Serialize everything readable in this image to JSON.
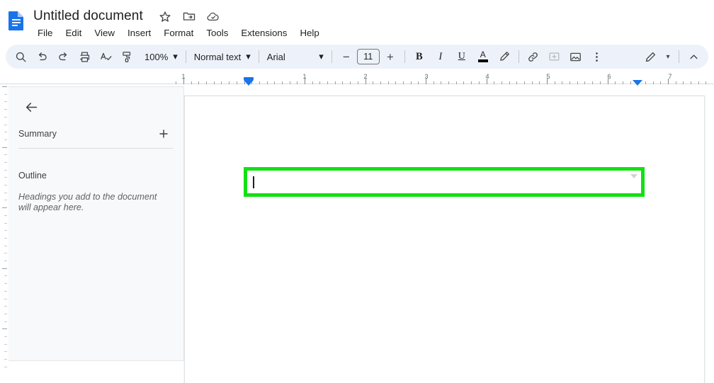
{
  "app": {
    "name": "Google Docs",
    "icon": "google-docs-icon"
  },
  "header": {
    "title": "Untitled document",
    "icons": [
      {
        "name": "star-icon",
        "label": "Star"
      },
      {
        "name": "move-to-folder-icon",
        "label": "Move"
      },
      {
        "name": "cloud-saved-icon",
        "label": "See document status"
      }
    ],
    "menus": [
      "File",
      "Edit",
      "View",
      "Insert",
      "Format",
      "Tools",
      "Extensions",
      "Help"
    ]
  },
  "toolbar": {
    "search_icon": "search-icon",
    "undo_icon": "undo-icon",
    "redo_icon": "redo-icon",
    "print_icon": "print-icon",
    "spellcheck_icon": "spellcheck-icon",
    "paint_format_icon": "paint-format-icon",
    "zoom_value": "100%",
    "style_value": "Normal text",
    "font_value": "Arial",
    "font_size_decrease": "−",
    "font_size_value": "11",
    "font_size_increase": "+",
    "bold_label": "B",
    "italic_label": "I",
    "underline_label": "U",
    "text_color_label": "A",
    "highlight_icon": "highlight-pen-icon",
    "link_icon": "insert-link-icon",
    "comment_icon": "add-comment-icon",
    "image_icon": "insert-image-icon",
    "more_icon": "more-options-icon",
    "edit_mode_icon": "edit-pencil-icon",
    "edit_mode_caret": "▾",
    "collapse_icon": "chevron-up-icon",
    "caret_glyph": "▾"
  },
  "ruler": {
    "horizontal_numbers": [
      "1",
      "1",
      "2",
      "3",
      "4",
      "5",
      "6",
      "7"
    ],
    "left_indent_marker": "left-indent-marker",
    "right_indent_marker": "right-indent-marker"
  },
  "sidebar": {
    "back_icon": "back-arrow-icon",
    "summary_label": "Summary",
    "add_summary_icon": "add-summary-plus-icon",
    "outline_label": "Outline",
    "outline_empty_text": "Headings you add to the document will appear here."
  },
  "document": {
    "active_line_text": "",
    "highlight_color": "#12e012",
    "cursor": "text-cursor"
  }
}
